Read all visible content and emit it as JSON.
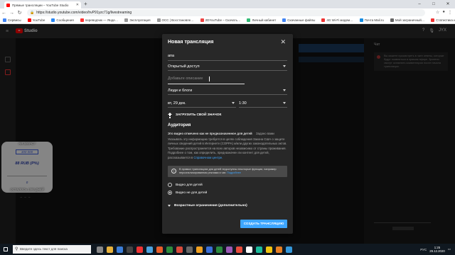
{
  "browser": {
    "tab_title": "Прямые трансляции – YouTube Studio",
    "url": "https://studio.youtube.com/video/hvP91yzc71g/livestreaming",
    "bookmarks": [
      {
        "label": "Сервисы",
        "color": "#4285f4"
      },
      {
        "label": "YouTube",
        "color": "#ff0000"
      },
      {
        "label": "Сообщения",
        "color": "#2787f5"
      },
      {
        "label": "переводчик — Янде…",
        "color": "#f33"
      },
      {
        "label": "Эксплуатация",
        "color": "#999"
      },
      {
        "label": "ОСС | Восстановле…",
        "color": "#999"
      },
      {
        "label": "2DYouTube – Скачать…",
        "color": "#e44"
      },
      {
        "label": "Личный кабинет",
        "color": "#3b7"
      },
      {
        "label": "Скачанные файлы",
        "color": "#4285f4"
      },
      {
        "label": "4G Wi-Fi модем…",
        "color": "#e33"
      },
      {
        "label": "Почта Mail.ru",
        "color": "#168de2"
      },
      {
        "label": "Мой заграничный…",
        "color": "#666"
      },
      {
        "label": "Статистика игрова…",
        "color": "#e33"
      }
    ]
  },
  "studio": {
    "logo": "Studio",
    "header_icons": [
      "?",
      "🎙",
      "JYX"
    ],
    "chat_title": "Чат",
    "chat_msg": "Вы можете просмотреть в чате ответы, которые будут появляться в прямом эфире. Зрители смогут оставлять комментарии после начала трансляции."
  },
  "ad": {
    "top": "НА МАРС?",
    "counter": "300 000",
    "price": "88 RUB (P%)",
    "zero": "0",
    "bottom": "ОСТАЛОСЬ 1000 ДНЕЙ",
    "dash": "– – –"
  },
  "dialog": {
    "title": "Новая трансляция",
    "stream_title": "апа",
    "privacy": "Открытый доступ",
    "description_placeholder": "Добавьте описание",
    "category": "Люди и блоги",
    "date": "вт, 29 дек.",
    "time": "1:30",
    "upload_label": "ЗАГРУЗИТЬ СВОЙ ЗНАЧОК",
    "audience_title": "Аудитория",
    "audience_question": "Это видео отмечено как не предназначенное для детей",
    "audience_link": "Задано вами",
    "audience_text": "Указывать эту информацию требуется в целях соблюдения Закона США о защите личных сведений детей в Интернете (COPPA) и/или других законодательных актов. Требование распространяется на всех авторов независимо от страны проживания. Подробнее о том, как определить, предназначен ли контент для детей, рассказывается в",
    "audience_text_link": "Справочном центре.",
    "info_text": "В прямых трансляциях для детей недоступны некоторые функции, например персонализированная реклама и чат.",
    "info_link": "Подробнее",
    "radio_for_kids": "Видео для детей",
    "radio_not_for_kids": "Видео не для детей",
    "age_restrictions": "Возрастные ограничения (дополнительно)",
    "create_button": "СОЗДАТЬ ТРАНСЛЯЦИЮ"
  },
  "taskbar": {
    "search_placeholder": "Введите здесь текст для поиска",
    "language": "РУС",
    "time": "1:25",
    "date": "29.12.2020"
  }
}
